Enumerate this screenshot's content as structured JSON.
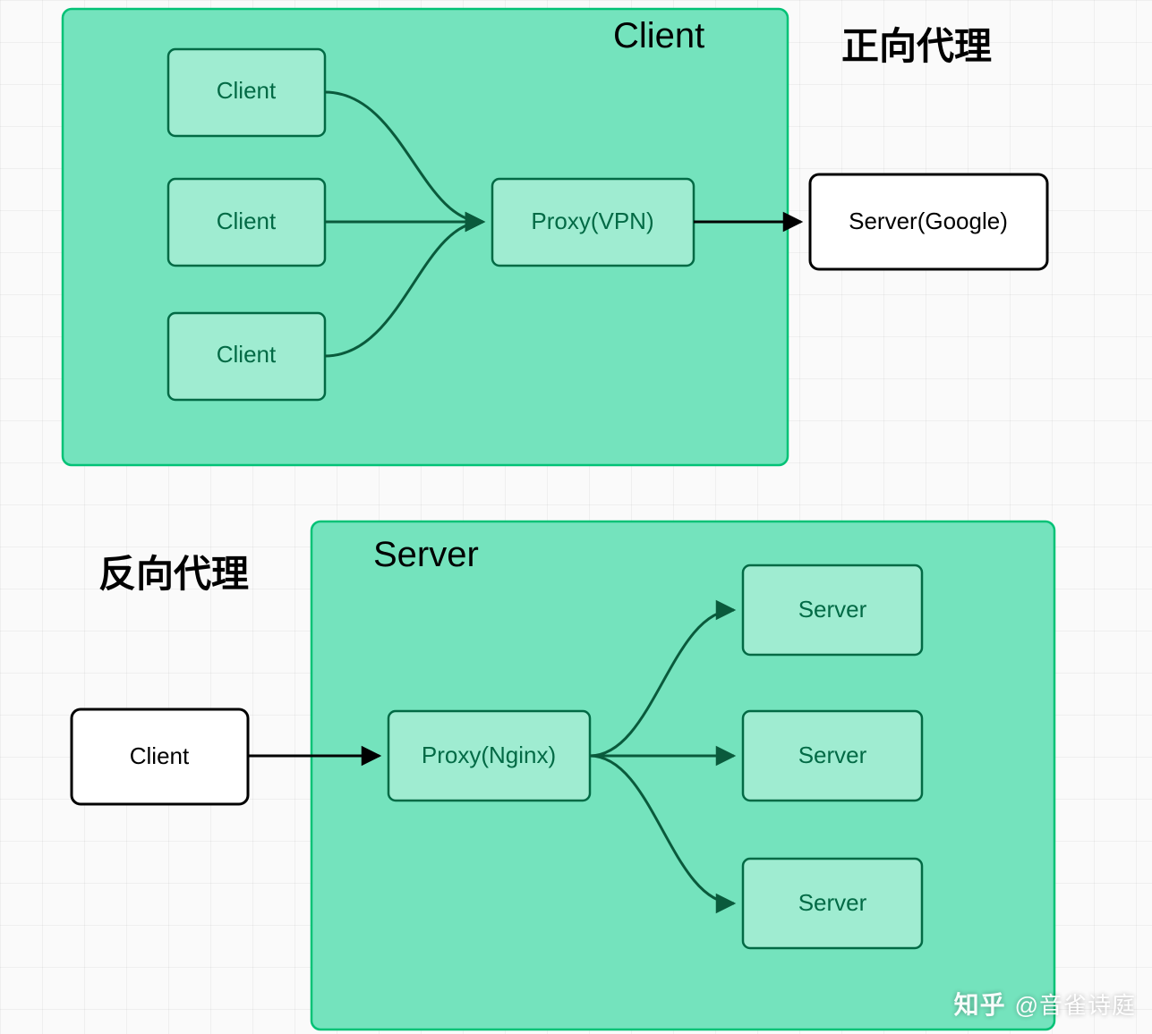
{
  "colors": {
    "group_fill": "#74e3bd",
    "group_stroke": "#02c276",
    "node_fill_green": "#9fecd1",
    "node_stroke_green": "#026a45",
    "node_fill_white": "#ffffff",
    "node_stroke_black": "#000000",
    "arrow_green": "#0a5a3c",
    "arrow_black": "#000000"
  },
  "diagram_top": {
    "title_zh": "正向代理",
    "group_label": "Client",
    "clients": [
      "Client",
      "Client",
      "Client"
    ],
    "proxy": "Proxy(VPN)",
    "server": "Server(Google)"
  },
  "diagram_bottom": {
    "title_zh": "反向代理",
    "group_label": "Server",
    "client": "Client",
    "proxy": "Proxy(Nginx)",
    "servers": [
      "Server",
      "Server",
      "Server"
    ]
  },
  "watermark": {
    "brand": "知乎",
    "author": "@音雀诗庭"
  }
}
